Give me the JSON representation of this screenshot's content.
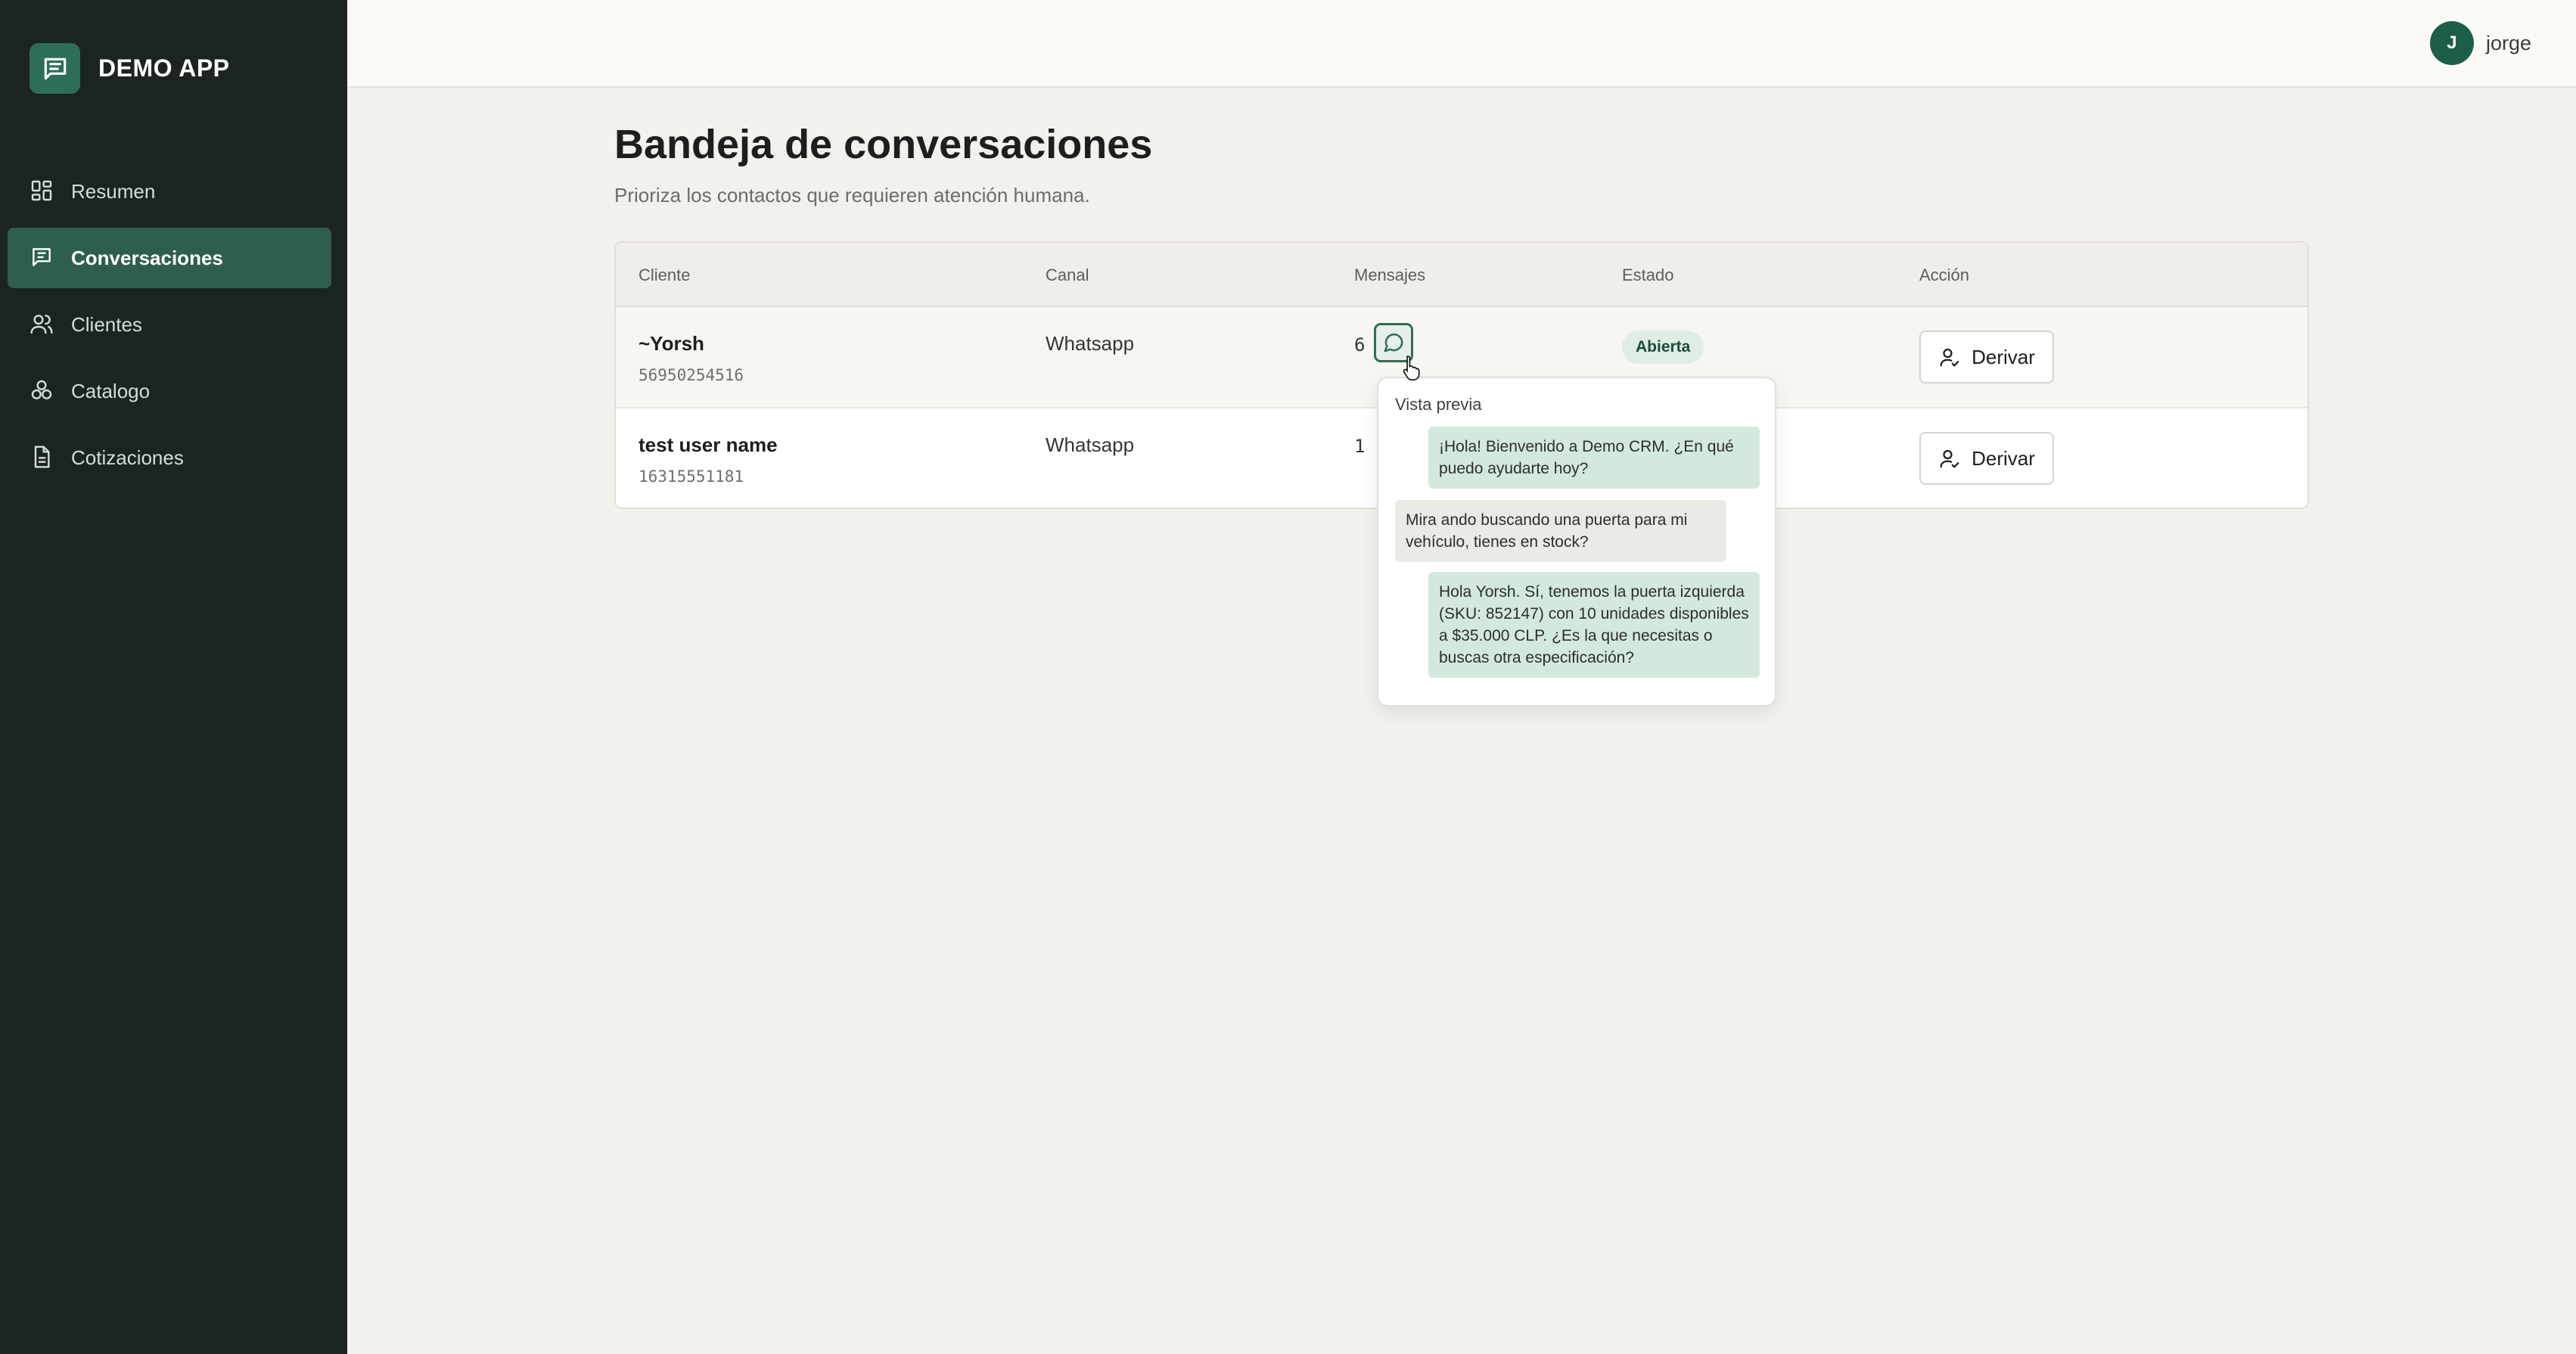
{
  "app": {
    "name": "DEMO APP"
  },
  "sidebar": {
    "items": [
      {
        "label": "Resumen",
        "icon": "dashboard-grid-icon",
        "active": false
      },
      {
        "label": "Conversaciones",
        "icon": "message-square-icon",
        "active": true
      },
      {
        "label": "Clientes",
        "icon": "users-icon",
        "active": false
      },
      {
        "label": "Catalogo",
        "icon": "boxes-icon",
        "active": false
      },
      {
        "label": "Cotizaciones",
        "icon": "file-text-icon",
        "active": false
      }
    ]
  },
  "user": {
    "initial": "J",
    "name": "jorge"
  },
  "page": {
    "title": "Bandeja de conversaciones",
    "subtitle": "Prioriza los contactos que requieren atención humana."
  },
  "table": {
    "headers": [
      "Cliente",
      "Canal",
      "Mensajes",
      "Estado",
      "Acción"
    ],
    "rows": [
      {
        "name": "~Yorsh",
        "phone": "56950254516",
        "channel": "Whatsapp",
        "messages": "6",
        "status": "Abierta",
        "action": "Derivar"
      },
      {
        "name": "test user name",
        "phone": "16315551181",
        "channel": "Whatsapp",
        "messages": "1",
        "status": "",
        "action": "Derivar"
      }
    ]
  },
  "preview": {
    "title": "Vista previa",
    "messages": [
      {
        "direction": "out",
        "text": "¡Hola! Bienvenido a Demo CRM. ¿En qué puedo ayudarte hoy?"
      },
      {
        "direction": "in",
        "text": "Mira ando buscando una puerta para mi vehículo, tienes en stock?"
      },
      {
        "direction": "out",
        "text": "Hola Yorsh. Sí, tenemos la puerta izquierda (SKU: 852147) con 10 unidades disponibles a $35.000 CLP. ¿Es la que necesitas o buscas otra especificación?"
      }
    ]
  },
  "colors": {
    "sidebar_bg": "#1c2421",
    "active_nav": "#2e5e4e",
    "accent": "#2e6e57",
    "outgoing_bubble": "#d4e9de",
    "status_badge": "#dfeee5"
  }
}
